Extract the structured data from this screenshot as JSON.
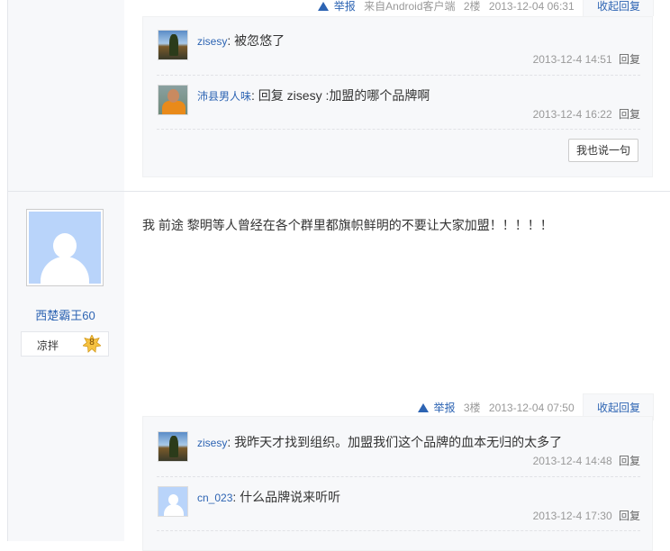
{
  "post_top": {
    "tail": {
      "report": "举报",
      "source": "来自Android客户端",
      "floor": "2楼",
      "time": "2013-12-04 06:31",
      "collapse": "收起回复"
    },
    "replies": [
      {
        "user": "zisesy",
        "colon": ":",
        "text": "被忽悠了",
        "time": "2013-12-4 14:51",
        "reply_btn": "回复",
        "avatar": "landscape"
      },
      {
        "user": "沛县男人味",
        "colon": ":",
        "text": "回复 zisesy :加盟的哪个品牌啊",
        "time": "2013-12-4 16:22",
        "reply_btn": "回复",
        "avatar": "soccer"
      }
    ],
    "say_button": "我也说一句"
  },
  "post_main": {
    "author": {
      "name": "西楚霸王60",
      "level_name": "凉拌",
      "level": "8"
    },
    "content": "我 前途 黎明等人曾经在各个群里都旗帜鲜明的不要让大家加盟！！！！！",
    "tail": {
      "report": "举报",
      "floor": "3楼",
      "time": "2013-12-04 07:50",
      "collapse": "收起回复"
    },
    "replies": [
      {
        "user": "zisesy",
        "colon": ":",
        "text": "我昨天才找到组织。加盟我们这个品牌的血本无归的太多了",
        "time": "2013-12-4 14:48",
        "reply_btn": "回复",
        "avatar": "landscape"
      },
      {
        "user": "cn_023",
        "colon": ":",
        "text": "什么品牌说来听听",
        "time": "2013-12-4 17:30",
        "reply_btn": "回复",
        "avatar": "default"
      }
    ]
  },
  "colors": {
    "link": "#2d64b3",
    "meta": "#999999",
    "panel": "#f7f8fa"
  },
  "icons": {
    "report": "warning-triangle-icon",
    "level": "star-badge-icon"
  }
}
